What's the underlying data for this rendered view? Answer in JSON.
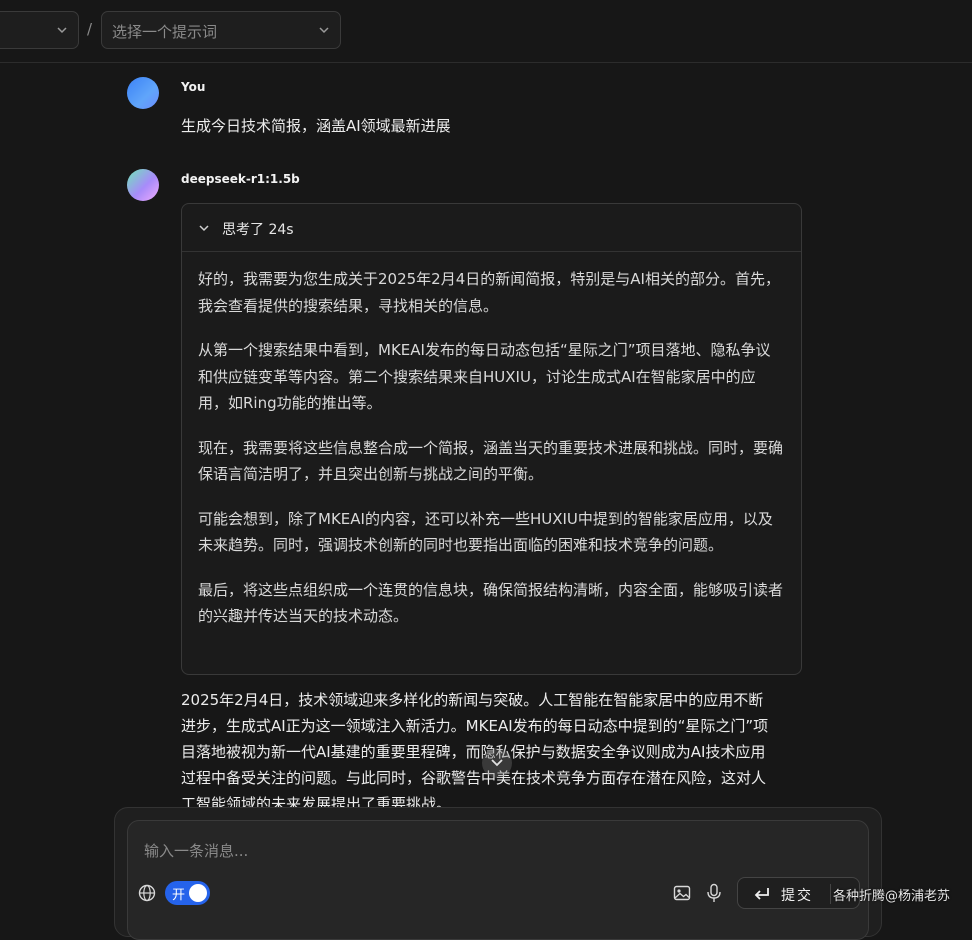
{
  "header": {
    "prompt_select_placeholder": "选择一个提示词",
    "separator": "/"
  },
  "messages": {
    "user": {
      "sender": "You",
      "text": "生成今日技术简报，涵盖AI领域最新进展"
    },
    "assistant": {
      "sender": "deepseek-r1:1.5b",
      "thinking_label": "思考了 24s",
      "thinking_paragraphs": [
        "好的，我需要为您生成关于2025年2月4日的新闻简报，特别是与AI相关的部分。首先，我会查看提供的搜索结果，寻找相关的信息。",
        "从第一个搜索结果中看到，MKEAI发布的每日动态包括“星际之门”项目落地、隐私争议和供应链变革等内容。第二个搜索结果来自HUXIU，讨论生成式AI在智能家居中的应用，如Ring功能的推出等。",
        "现在，我需要将这些信息整合成一个简报，涵盖当天的重要技术进展和挑战。同时，要确保语言简洁明了，并且突出创新与挑战之间的平衡。",
        "可能会想到，除了MKEAI的内容，还可以补充一些HUXIU中提到的智能家居应用，以及未来趋势。同时，强调技术创新的同时也要指出面临的困难和技术竞争的问题。",
        "最后，将这些点组织成一个连贯的信息块，确保简报结构清晰，内容全面，能够吸引读者的兴趣并传达当天的技术动态。"
      ],
      "answer": "2025年2月4日，技术领域迎来多样化的新闻与突破。人工智能在智能家居中的应用不断进步，生成式AI正为这一领域注入新活力。MKEAI发布的每日动态中提到的“星际之门”项目落地被视为新一代AI基建的重要里程碑，而隐私保护与数据安全争议则成为AI技术应用过程中备受关注的问题。与此同时，谷歌警告中美在技术竞争方面存在潜在风险，这对人工智能领域的未来发展提出了重要挑战。"
    }
  },
  "composer": {
    "placeholder": "输入一条消息...",
    "toggle_label": "开",
    "submit_label": "提交"
  },
  "watermark": "各种折腾@杨浦老苏",
  "colors": {
    "background": "#171717",
    "accent": "#2563eb"
  }
}
